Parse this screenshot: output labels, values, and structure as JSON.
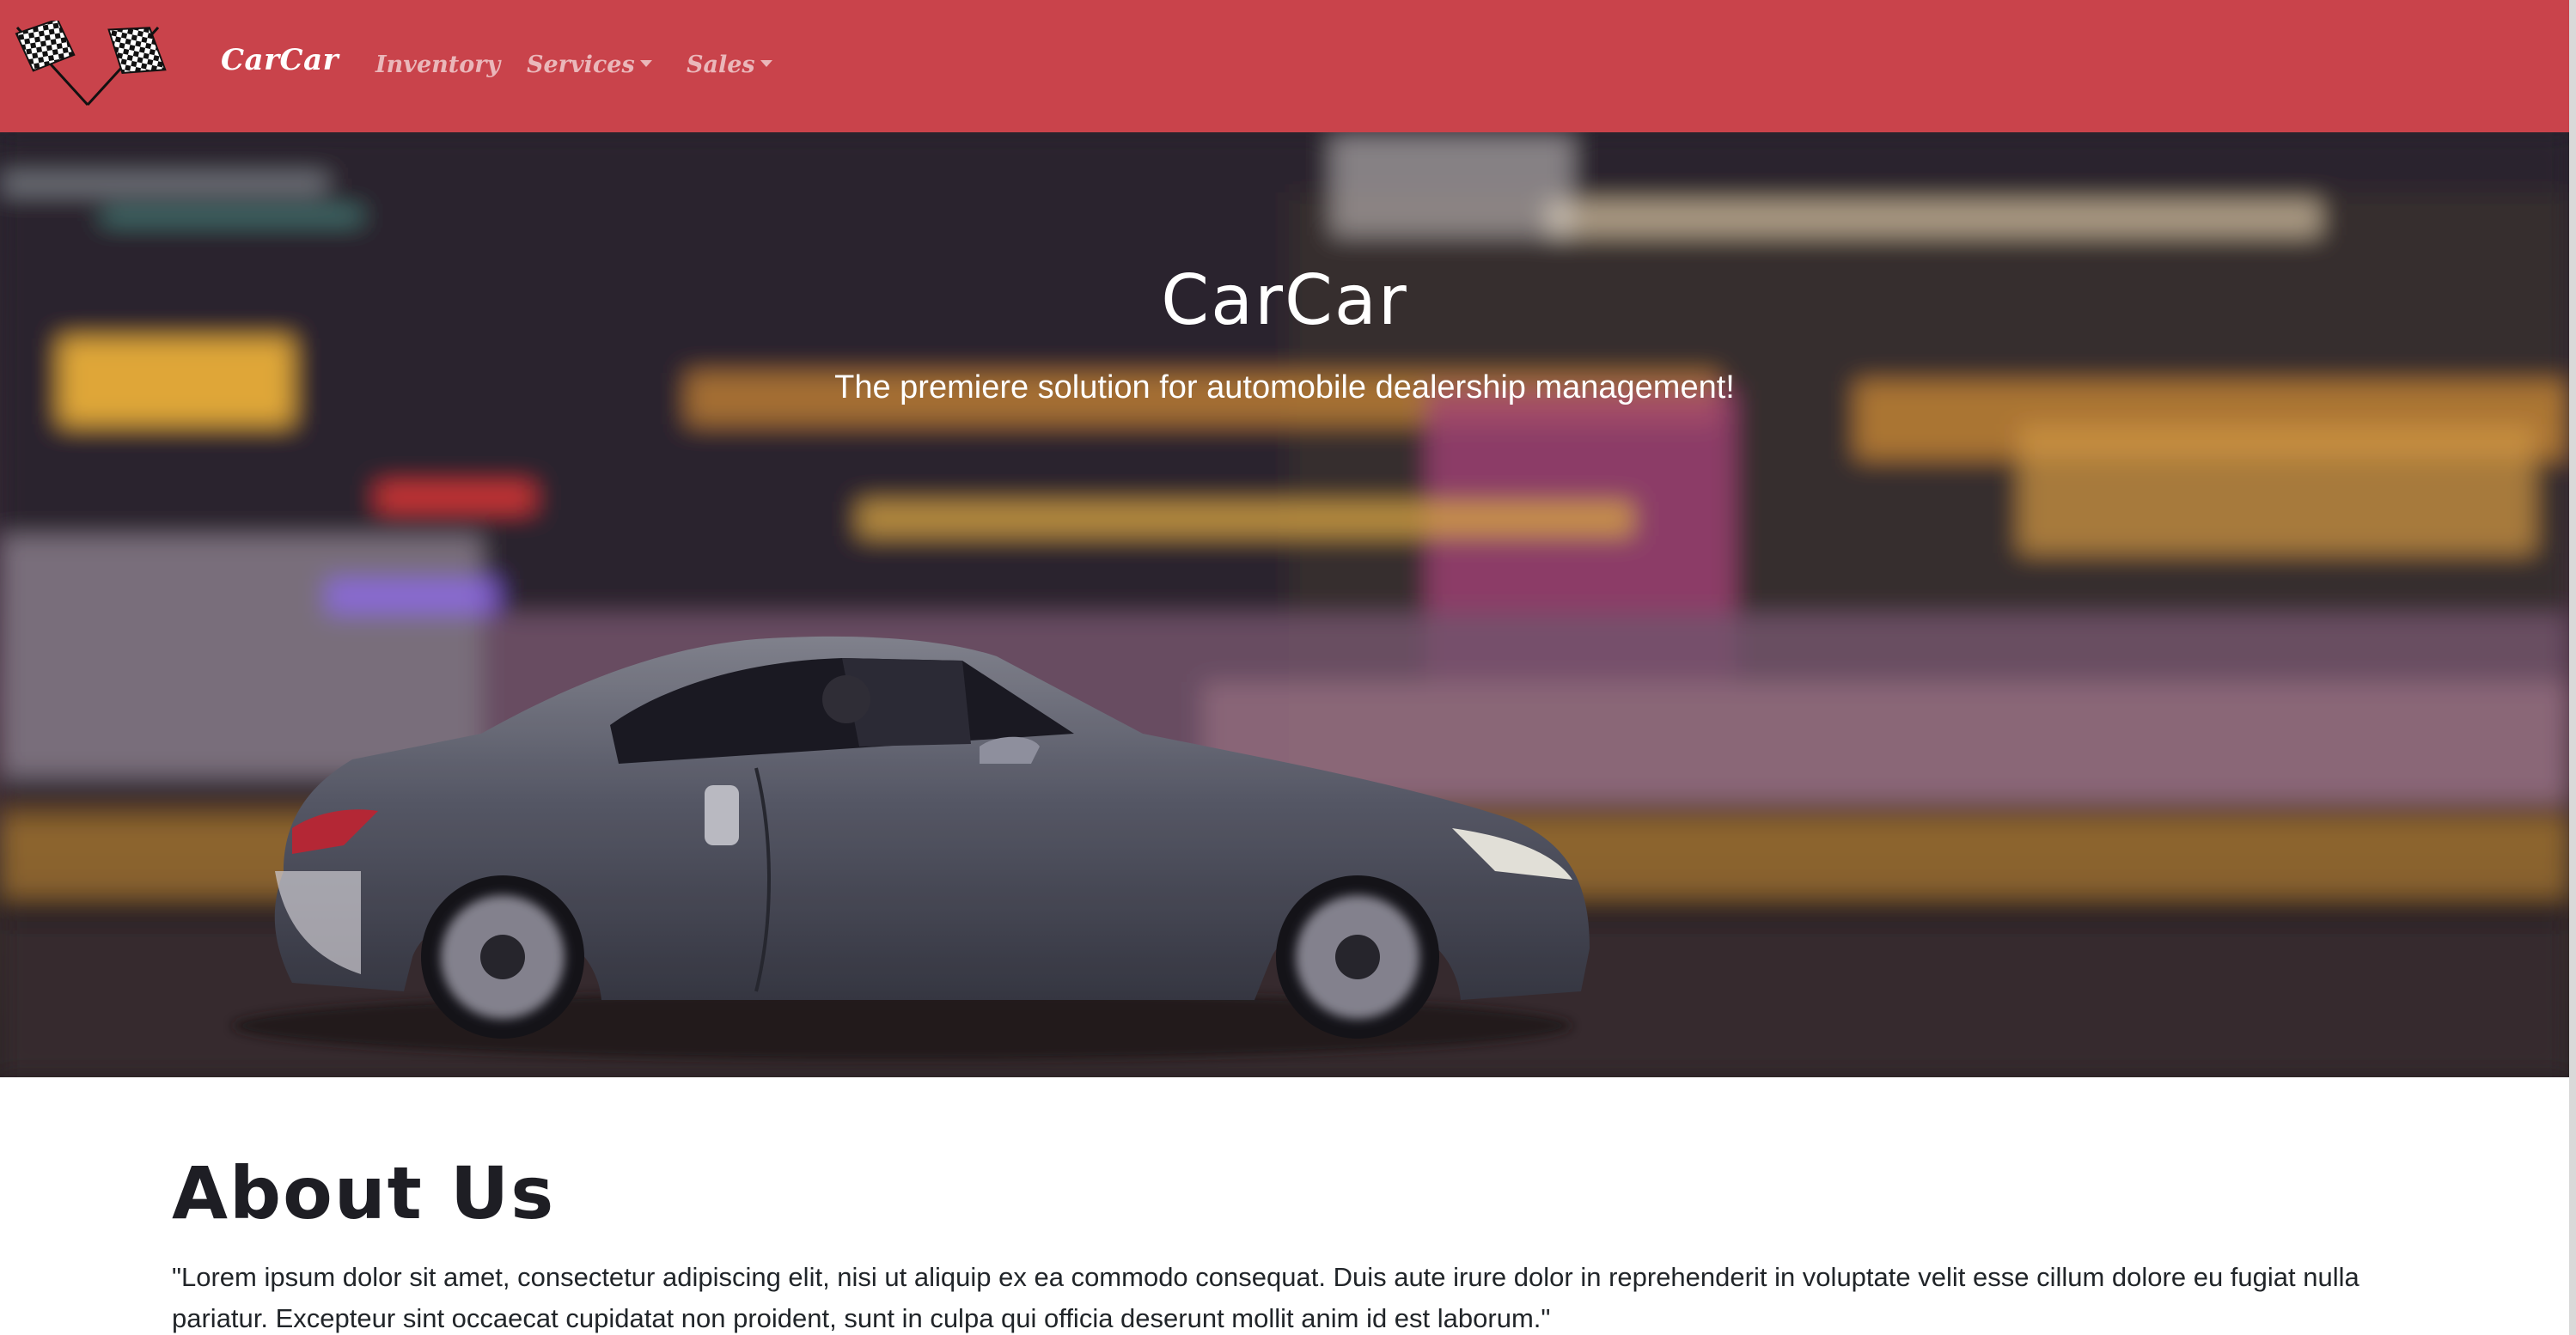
{
  "nav": {
    "brand": "CarCar",
    "links": [
      {
        "label": "Inventory",
        "has_dropdown": false
      },
      {
        "label": "Services",
        "has_dropdown": true
      },
      {
        "label": "Sales",
        "has_dropdown": true
      }
    ],
    "logo_icon": "checkered-flags-icon"
  },
  "hero": {
    "title": "CarCar",
    "tagline": "The premiere solution for automobile dealership management!",
    "image_icon": "sports-car-image"
  },
  "about": {
    "heading": "About Us",
    "text": "\"Lorem ipsum dolor sit amet, consectetur adipiscing elit, nisi ut aliquip ex ea commodo consequat. Duis aute irure dolor in reprehenderit in voluptate velit esse cillum dolore eu fugiat nulla pariatur. Excepteur sint occaecat cupidatat non proident, sunt in culpa qui officia deserunt mollit anim id est laborum.\""
  },
  "colors": {
    "navbar": "#c9434b",
    "heading": "#1e1e24",
    "body_text": "#212529"
  }
}
